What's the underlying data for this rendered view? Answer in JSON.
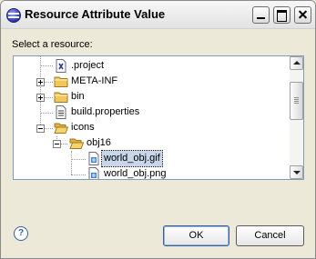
{
  "window": {
    "title": "Resource Attribute Value"
  },
  "titlebar_buttons": [
    "minimize",
    "maximize",
    "close"
  ],
  "prompt": "Select a resource:",
  "tree": {
    "items": [
      {
        "label": ".project",
        "icon": "xml-file-icon",
        "expandable": false,
        "expanded": false,
        "selected": false
      },
      {
        "label": "META-INF",
        "icon": "folder-icon",
        "expandable": true,
        "expanded": false,
        "selected": false
      },
      {
        "label": "bin",
        "icon": "folder-icon",
        "expandable": true,
        "expanded": false,
        "selected": false
      },
      {
        "label": "build.properties",
        "icon": "properties-file-icon",
        "expandable": false,
        "expanded": false,
        "selected": false
      },
      {
        "label": "icons",
        "icon": "folder-open-icon",
        "expandable": true,
        "expanded": true,
        "selected": false
      },
      {
        "label": "obj16",
        "icon": "folder-open-icon",
        "expandable": true,
        "expanded": true,
        "selected": false
      },
      {
        "label": "world_obj.gif",
        "icon": "image-file-icon",
        "expandable": false,
        "expanded": false,
        "selected": true
      },
      {
        "label": "world_obj.png",
        "icon": "image-file-icon",
        "expandable": false,
        "expanded": false,
        "selected": false
      }
    ]
  },
  "buttons": {
    "ok": "OK",
    "cancel": "Cancel",
    "help": "?"
  },
  "colors": {
    "dialog_background": "#ece9d8",
    "tree_border": "#7f9db9",
    "selection": "#c8d6ea",
    "folder": "#f0c85a"
  }
}
